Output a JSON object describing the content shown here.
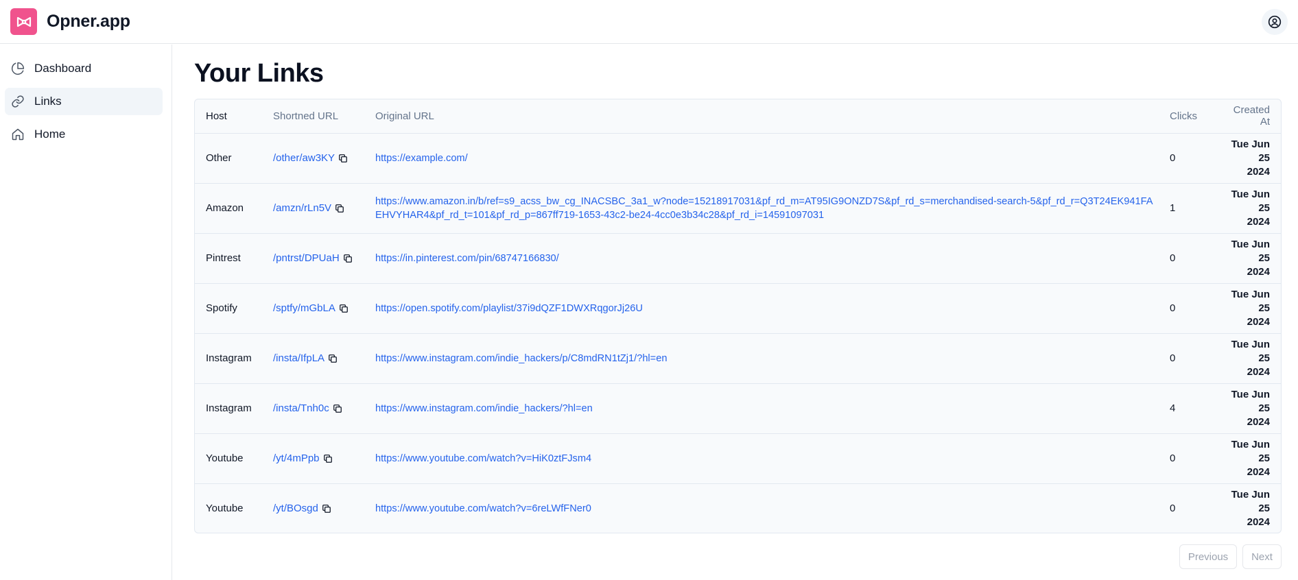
{
  "app": {
    "name": "Opner.app"
  },
  "sidebar": {
    "items": [
      {
        "label": "Dashboard"
      },
      {
        "label": "Links"
      },
      {
        "label": "Home"
      }
    ]
  },
  "main": {
    "title": "Your Links"
  },
  "table": {
    "headers": {
      "host": "Host",
      "short": "Shortned URL",
      "original": "Original URL",
      "clicks": "Clicks",
      "created": "Created At"
    },
    "rows": [
      {
        "host": "Other",
        "short": "/other/aw3KY",
        "original": "https://example.com/",
        "clicks": "0",
        "created_day": "Tue Jun 25",
        "created_year": "2024"
      },
      {
        "host": "Amazon",
        "short": "/amzn/rLn5V",
        "original": "https://www.amazon.in/b/ref=s9_acss_bw_cg_INACSBC_3a1_w?node=15218917031&pf_rd_m=AT95IG9ONZD7S&pf_rd_s=merchandised-search-5&pf_rd_r=Q3T24EK941FAEHVYHAR4&pf_rd_t=101&pf_rd_p=867ff719-1653-43c2-be24-4cc0e3b34c28&pf_rd_i=14591097031",
        "clicks": "1",
        "created_day": "Tue Jun 25",
        "created_year": "2024"
      },
      {
        "host": "Pintrest",
        "short": "/pntrst/DPUaH",
        "original": "https://in.pinterest.com/pin/68747166830/",
        "clicks": "0",
        "created_day": "Tue Jun 25",
        "created_year": "2024"
      },
      {
        "host": "Spotify",
        "short": "/sptfy/mGbLA",
        "original": "https://open.spotify.com/playlist/37i9dQZF1DWXRqgorJj26U",
        "clicks": "0",
        "created_day": "Tue Jun 25",
        "created_year": "2024"
      },
      {
        "host": "Instagram",
        "short": "/insta/IfpLA",
        "original": "https://www.instagram.com/indie_hackers/p/C8mdRN1tZj1/?hl=en",
        "clicks": "0",
        "created_day": "Tue Jun 25",
        "created_year": "2024"
      },
      {
        "host": "Instagram",
        "short": "/insta/Tnh0c",
        "original": "https://www.instagram.com/indie_hackers/?hl=en",
        "clicks": "4",
        "created_day": "Tue Jun 25",
        "created_year": "2024"
      },
      {
        "host": "Youtube",
        "short": "/yt/4mPpb",
        "original": "https://www.youtube.com/watch?v=HiK0ztFJsm4",
        "clicks": "0",
        "created_day": "Tue Jun 25",
        "created_year": "2024"
      },
      {
        "host": "Youtube",
        "short": "/yt/BOsgd",
        "original": "https://www.youtube.com/watch?v=6reLWfFNer0",
        "clicks": "0",
        "created_day": "Tue Jun 25",
        "created_year": "2024"
      }
    ]
  },
  "pagination": {
    "previous": "Previous",
    "next": "Next"
  },
  "colors": {
    "brand": "#f0538d",
    "link": "#2563eb"
  },
  "icons": {
    "logo": "bowtie-logo-icon",
    "avatar": "user-circle-icon",
    "dashboard": "pie-chart-icon",
    "links": "link-icon",
    "home": "home-icon",
    "copy": "copy-icon"
  }
}
